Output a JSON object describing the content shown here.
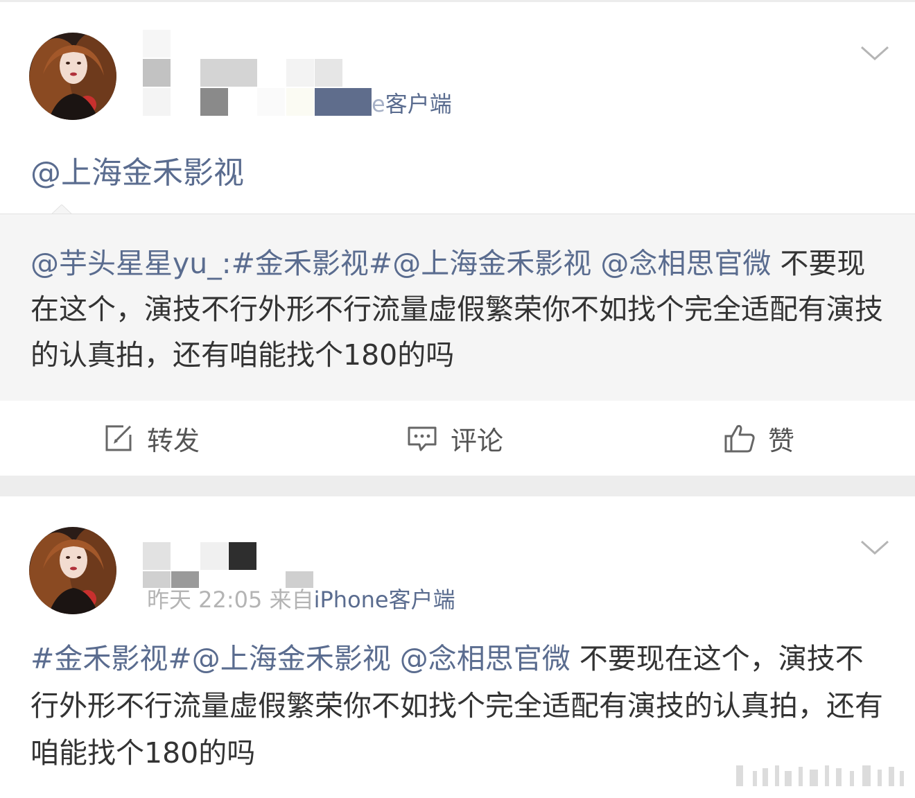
{
  "post1": {
    "meta_suffix": "e",
    "client": "客户端",
    "mention": "@上海金禾影视",
    "retweet": {
      "author_mention": "@芋头星星yu_",
      "colon": ":",
      "hashtag": "#金禾影视#",
      "mention1": "@上海金禾影视",
      "mention2": "@念相思官微",
      "body": " 不要现在这个，演技不行外形不行流量虚假繁荣你不如找个完全适配有演技的认真拍，还有咱能找个180的吗"
    },
    "actions": {
      "repost_label": "转发",
      "comment_label": "评论",
      "like_label": "赞"
    }
  },
  "post2": {
    "time": "昨天 22:05",
    "from": "来自",
    "client": "iPhone客户端",
    "hashtag": "#金禾影视#",
    "mention1": "@上海金禾影视",
    "mention2": "@念相思官微",
    "body": " 不要现在这个，演技不行外形不行流量虚假繁荣你不如找个完全适配有演技的认真拍，还有咱能找个180的吗"
  },
  "icons": {
    "repost": "edit-square-icon",
    "comment": "comment-bubble-icon",
    "like": "thumbs-up-icon",
    "menu": "chevron-down-icon"
  },
  "colors": {
    "link": "#5a6c8f",
    "text": "#333333",
    "meta": "#9a9a9a",
    "retweet_bg": "#f5f5f5",
    "separator": "#ededed"
  }
}
